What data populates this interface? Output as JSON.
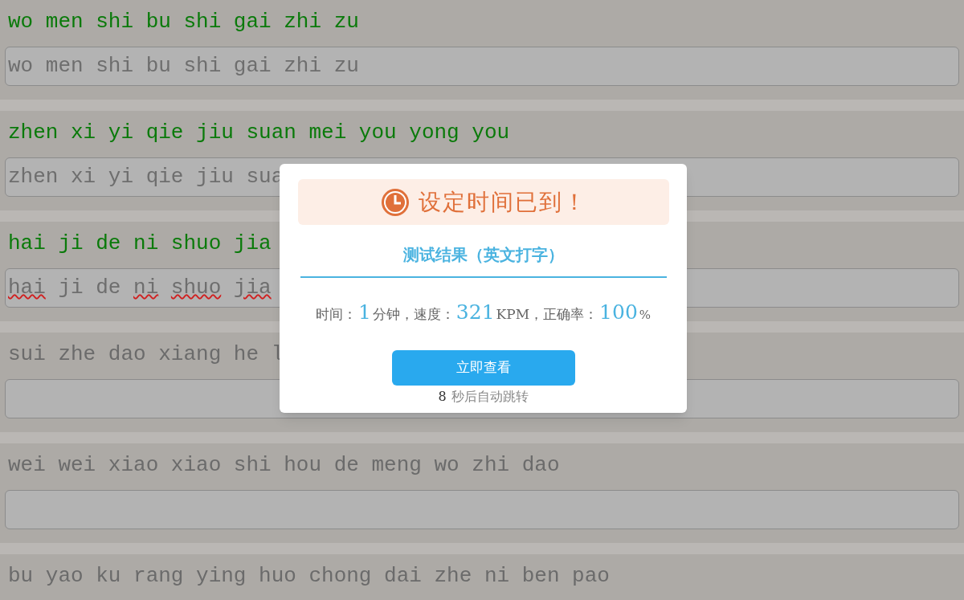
{
  "lines": [
    {
      "prompt": "wo men shi bu shi gai zhi zu",
      "completed": true,
      "typed": [
        {
          "text": "wo men shi bu shi gai zhi zu",
          "misspelled": false
        }
      ]
    },
    {
      "prompt": "zhen xi yi qie jiu suan mei you yong you",
      "completed": true,
      "typed": [
        {
          "text": "zhen xi yi qie jiu sua",
          "misspelled": false
        }
      ]
    },
    {
      "prompt": "hai ji de ni shuo jia",
      "completed": true,
      "typed": [
        {
          "text": "hai",
          "misspelled": true
        },
        {
          "text": "ji",
          "misspelled": false
        },
        {
          "text": "de",
          "misspelled": false
        },
        {
          "text": "ni",
          "misspelled": true
        },
        {
          "text": "shuo",
          "misspelled": true
        },
        {
          "text": "jia",
          "misspelled": true
        }
      ]
    },
    {
      "prompt": "sui zhe dao xiang he l",
      "completed": false
    },
    {
      "prompt": "wei wei xiao xiao shi hou de meng wo zhi dao",
      "completed": false
    },
    {
      "prompt": "bu yao ku rang ying huo chong dai zhe ni ben pao",
      "completed": false
    }
  ],
  "dialog": {
    "heading": "设定时间已到！",
    "title": "测试结果（英文打字）",
    "stats": [
      {
        "kind": "label",
        "text": "时间："
      },
      {
        "kind": "value",
        "text": "1"
      },
      {
        "kind": "label",
        "text": "分钟，速度："
      },
      {
        "kind": "value",
        "text": "321"
      },
      {
        "kind": "label",
        "text": "KPM，正确率："
      },
      {
        "kind": "value",
        "text": "100"
      },
      {
        "kind": "unit",
        "text": "%"
      }
    ],
    "button": "立即查看",
    "countdown": "8",
    "countdown_text": "秒后自动跳转"
  }
}
